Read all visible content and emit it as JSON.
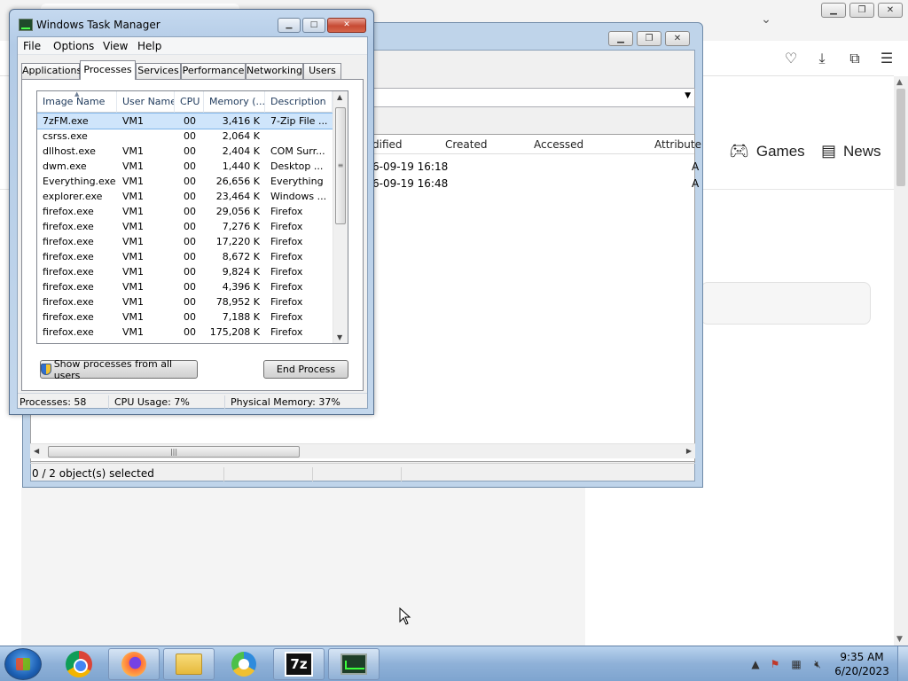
{
  "browser": {
    "nav_links": [
      {
        "label": "Games",
        "icon": "gamepad-icon"
      },
      {
        "label": "News",
        "icon": "newspaper-icon"
      }
    ],
    "partial_link": "s"
  },
  "zip": {
    "columns": [
      "dified",
      "Created",
      "Accessed",
      "Attribute"
    ],
    "rows": [
      {
        "modified": "6-09-19 16:18",
        "attr": "A"
      },
      {
        "modified": "6-09-19 16:48",
        "attr": "A"
      }
    ],
    "status": "0 / 2 object(s) selected"
  },
  "taskmgr": {
    "title": "Windows Task Manager",
    "menu": [
      "File",
      "Options",
      "View",
      "Help"
    ],
    "tabs": [
      "Applications",
      "Processes",
      "Services",
      "Performance",
      "Networking",
      "Users"
    ],
    "active_tab": "Processes",
    "columns": [
      "Image Name",
      "User Name",
      "CPU",
      "Memory (...",
      "Description"
    ],
    "processes": [
      {
        "name": "7zFM.exe",
        "user": "VM1",
        "cpu": "00",
        "mem": "3,416 K",
        "desc": "7-Zip File ..."
      },
      {
        "name": "csrss.exe",
        "user": "",
        "cpu": "00",
        "mem": "2,064 K",
        "desc": ""
      },
      {
        "name": "dllhost.exe",
        "user": "VM1",
        "cpu": "00",
        "mem": "2,404 K",
        "desc": "COM Surr..."
      },
      {
        "name": "dwm.exe",
        "user": "VM1",
        "cpu": "00",
        "mem": "1,440 K",
        "desc": "Desktop ..."
      },
      {
        "name": "Everything.exe",
        "user": "VM1",
        "cpu": "00",
        "mem": "26,656 K",
        "desc": "Everything"
      },
      {
        "name": "explorer.exe",
        "user": "VM1",
        "cpu": "00",
        "mem": "23,464 K",
        "desc": "Windows ..."
      },
      {
        "name": "firefox.exe",
        "user": "VM1",
        "cpu": "00",
        "mem": "29,056 K",
        "desc": "Firefox"
      },
      {
        "name": "firefox.exe",
        "user": "VM1",
        "cpu": "00",
        "mem": "7,276 K",
        "desc": "Firefox"
      },
      {
        "name": "firefox.exe",
        "user": "VM1",
        "cpu": "00",
        "mem": "17,220 K",
        "desc": "Firefox"
      },
      {
        "name": "firefox.exe",
        "user": "VM1",
        "cpu": "00",
        "mem": "8,672 K",
        "desc": "Firefox"
      },
      {
        "name": "firefox.exe",
        "user": "VM1",
        "cpu": "00",
        "mem": "9,824 K",
        "desc": "Firefox"
      },
      {
        "name": "firefox.exe",
        "user": "VM1",
        "cpu": "00",
        "mem": "4,396 K",
        "desc": "Firefox"
      },
      {
        "name": "firefox.exe",
        "user": "VM1",
        "cpu": "00",
        "mem": "78,952 K",
        "desc": "Firefox"
      },
      {
        "name": "firefox.exe",
        "user": "VM1",
        "cpu": "00",
        "mem": "7,188 K",
        "desc": "Firefox"
      },
      {
        "name": "firefox.exe",
        "user": "VM1",
        "cpu": "00",
        "mem": "175,208 K",
        "desc": "Firefox"
      }
    ],
    "selected_index": 0,
    "show_all_label": "Show processes from all users",
    "end_process_label": "End Process",
    "status": {
      "processes": "Processes: 58",
      "cpu": "CPU Usage: 7%",
      "memory": "Physical Memory: 37%"
    }
  },
  "taskbar": {
    "apps": [
      "chrome-icon",
      "firefox-icon",
      "file-explorer-icon",
      "keepass-icon",
      "7zip-icon",
      "task-manager-icon"
    ],
    "seven_zip_label": "7z",
    "clock_time": "9:35 AM",
    "clock_date": "6/20/2023"
  },
  "colors": {
    "selection_bg": "#cfe5fb",
    "taskbar": "#8fb1d8",
    "close_button": "#c74a33"
  }
}
